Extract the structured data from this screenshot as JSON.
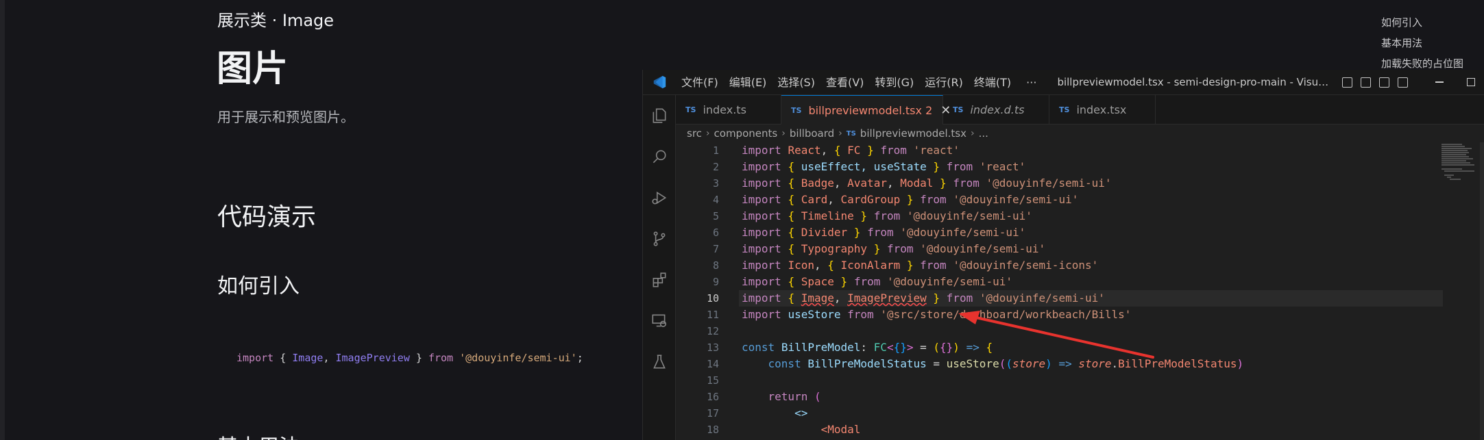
{
  "docs": {
    "breadcrumb": "展示类 · Image",
    "title": "图片",
    "description": "用于展示和预览图片。",
    "section_demo": "代码演示",
    "section_import": "如何引入",
    "section_basic": "基本用法",
    "import_code": {
      "kw1": "import",
      "brace_open": " { ",
      "id1": "Image",
      "comma": ", ",
      "id2": "ImagePreview",
      "brace_close": " } ",
      "kw2": "from",
      "str": " '@douyinfe/semi-ui'",
      "semi": ";"
    },
    "toc": [
      "如何引入",
      "基本用法",
      "加载失败的占位图"
    ]
  },
  "vscode": {
    "menu": [
      "文件(F)",
      "编辑(E)",
      "选择(S)",
      "查看(V)",
      "转到(G)",
      "运行(R)",
      "终端(T)"
    ],
    "menu_more": "···",
    "window_title": "billpreviewmodel.tsx - semi-design-pro-main - Visual Stu...",
    "tabs": [
      {
        "badge": "TS",
        "label": "index.ts"
      },
      {
        "badge": "TS",
        "label": "billpreviewmodel.tsx 2",
        "close": "✕"
      },
      {
        "badge": "TS",
        "label": "index.d.ts"
      },
      {
        "badge": "TS",
        "label": "index.tsx"
      }
    ],
    "breadcrumbs": [
      "src",
      "components",
      "billboard",
      "billpreviewmodel.tsx",
      "..."
    ],
    "breadcrumb_badge": "TS",
    "line_numbers": [
      "1",
      "2",
      "3",
      "4",
      "5",
      "6",
      "7",
      "8",
      "9",
      "10",
      "11",
      "12",
      "13",
      "14",
      "15",
      "16",
      "17",
      "18"
    ],
    "current_line": "10"
  },
  "colors": {
    "accent": "#0078d4",
    "error_tab": "#f48771",
    "arrow": "#e8332e"
  }
}
